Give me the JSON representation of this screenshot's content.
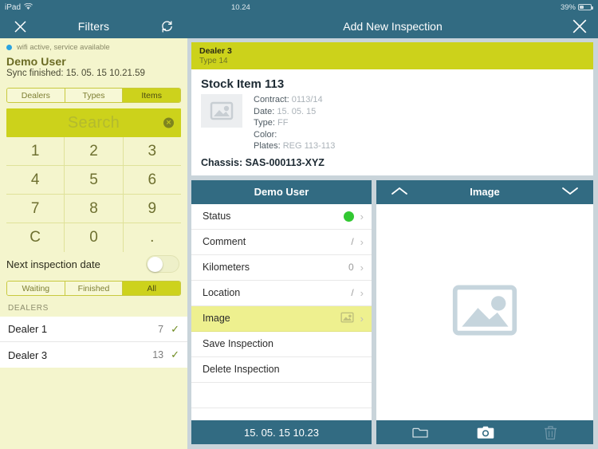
{
  "status_bar": {
    "device": "iPad",
    "wifi_icon": "wifi-icon",
    "time": "10.24",
    "battery_percent": "39%",
    "battery_level": 39
  },
  "left_panel": {
    "navbar": {
      "close_icon": "close-icon",
      "title": "Filters",
      "refresh_icon": "refresh-icon"
    },
    "sync": {
      "connection_status": "wifi active, service available",
      "user": "Demo User",
      "sync_line": "Sync finished: 15. 05. 15 10.21.59"
    },
    "segments": [
      {
        "label": "Dealers",
        "active": false
      },
      {
        "label": "Types",
        "active": false
      },
      {
        "label": "Items",
        "active": true
      }
    ],
    "search": {
      "placeholder": "Search",
      "value": "",
      "clear_icon": "clear-icon"
    },
    "keypad": [
      [
        "1",
        "2",
        "3"
      ],
      [
        "4",
        "5",
        "6"
      ],
      [
        "7",
        "8",
        "9"
      ],
      [
        "C",
        "0",
        "."
      ]
    ],
    "next_inspection": {
      "label": "Next inspection date",
      "enabled": false
    },
    "state_filter": [
      {
        "label": "Waiting",
        "active": false
      },
      {
        "label": "Finished",
        "active": false
      },
      {
        "label": "All",
        "active": true
      }
    ],
    "dealers_header": "DEALERS",
    "dealers": [
      {
        "name": "Dealer 1",
        "count": "7",
        "selected": true
      },
      {
        "name": "Dealer 3",
        "count": "13",
        "selected": true
      }
    ]
  },
  "right_panel": {
    "navbar": {
      "title": "Add New Inspection",
      "close_icon": "close-icon"
    },
    "stock_card": {
      "dealer": "Dealer 3",
      "type_line": "Type 14",
      "title": "Stock Item 113",
      "thumbnail_icon": "image-placeholder-icon",
      "details": [
        {
          "key": "Contract:",
          "value": "0113/14"
        },
        {
          "key": "Date:",
          "value": "15. 05. 15"
        },
        {
          "key": "Type:",
          "value": "FF"
        },
        {
          "key": "Color:",
          "value": ""
        },
        {
          "key": "Plates:",
          "value": "REG 113-113"
        }
      ],
      "chassis": "Chassis: SAS-000113-XYZ"
    },
    "inspection_pane": {
      "header": "Demo User",
      "rows": [
        {
          "label": "Status",
          "value": "",
          "indicator": "green-dot",
          "highlighted": false
        },
        {
          "label": "Comment",
          "value": "/",
          "indicator": "",
          "highlighted": false
        },
        {
          "label": "Kilometers",
          "value": "0",
          "indicator": "",
          "highlighted": false
        },
        {
          "label": "Location",
          "value": "/",
          "indicator": "",
          "highlighted": false
        },
        {
          "label": "Image",
          "value": "",
          "indicator": "image-icon",
          "highlighted": true
        },
        {
          "label": "Save Inspection",
          "value": "",
          "indicator": "",
          "highlighted": false
        },
        {
          "label": "Delete Inspection",
          "value": "",
          "indicator": "",
          "highlighted": false
        }
      ],
      "footer_timestamp": "15. 05. 15 10.23"
    },
    "image_pane": {
      "prev_icon": "chevron-up-icon",
      "header": "Image",
      "next_icon": "chevron-down-icon",
      "placeholder_icon": "image-placeholder-icon",
      "toolbar": [
        {
          "icon": "folder-icon",
          "enabled": true
        },
        {
          "icon": "camera-icon",
          "enabled": true
        },
        {
          "icon": "trash-icon",
          "enabled": false
        }
      ]
    }
  },
  "colors": {
    "navy": "#326b82",
    "lime": "#ccd21b",
    "cream": "#f4f5cd",
    "highlight": "#eef08f",
    "status_green": "#32c832",
    "page_background": "#c9d4da"
  }
}
